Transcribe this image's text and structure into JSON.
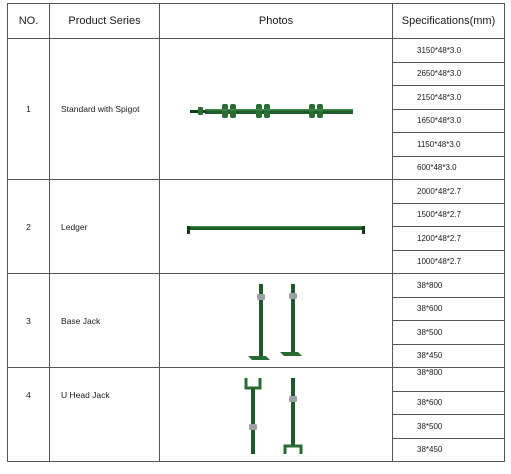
{
  "headers": {
    "no": "NO.",
    "series": "Product Series",
    "photos": "Photos",
    "specs": "Specifications(mm)"
  },
  "rows": [
    {
      "no": "1",
      "name": "Standard with Spigot",
      "specs": [
        "3150*48*3.0",
        "2650*48*3.0",
        "2150*48*3.0",
        "1650*48*3.0",
        "1150*48*3.0",
        "600*48*3.0"
      ]
    },
    {
      "no": "2",
      "name": "Ledger",
      "specs": [
        "2000*48*2.7",
        "1500*48*2.7",
        "1200*48*2.7",
        "1000*48*2.7"
      ]
    },
    {
      "no": "3",
      "name": "Base Jack",
      "specs": [
        "38*800",
        "38*600",
        "38*500",
        "38*450"
      ]
    },
    {
      "no": "4",
      "name": "U Head Jack",
      "specs": [
        "38*800",
        "38*600",
        "38*500",
        "38*450"
      ]
    }
  ],
  "colors": {
    "pipe": "#1f5a2a",
    "pipe_dark": "#123d1a",
    "plate": "#2a6b34",
    "nut": "#9aa0a4"
  }
}
